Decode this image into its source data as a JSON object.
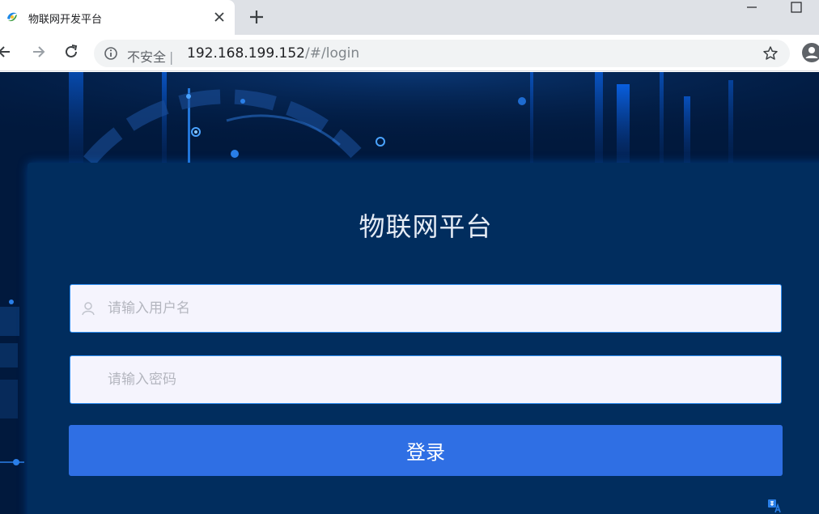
{
  "browser": {
    "tab": {
      "title": "物联网开发平台"
    },
    "address": {
      "security_label": "不安全",
      "separator": "|",
      "host": "192.168.199.152",
      "path": "/#/login"
    }
  },
  "icons": {
    "favicon": "favicon-icon",
    "close": "close-icon",
    "new_tab": "plus-icon",
    "minimize": "minimize-icon",
    "maximize": "maximize-icon",
    "back": "arrow-left-icon",
    "forward": "arrow-right-icon",
    "reload": "reload-icon",
    "info": "info-icon",
    "star": "star-icon",
    "profile": "profile-icon",
    "user": "user-icon",
    "language": "translate-icon"
  },
  "login": {
    "title": "物联网平台",
    "username": {
      "placeholder": "请输入用户名",
      "value": ""
    },
    "password": {
      "placeholder": "请输入密码",
      "value": ""
    },
    "submit_label": "登录"
  },
  "colors": {
    "page_bg": "#01193d",
    "card_bg": "#012d5e",
    "input_bg": "#f5f4fd",
    "input_border": "#2d8cf0",
    "button_bg": "#2f6fe4"
  }
}
